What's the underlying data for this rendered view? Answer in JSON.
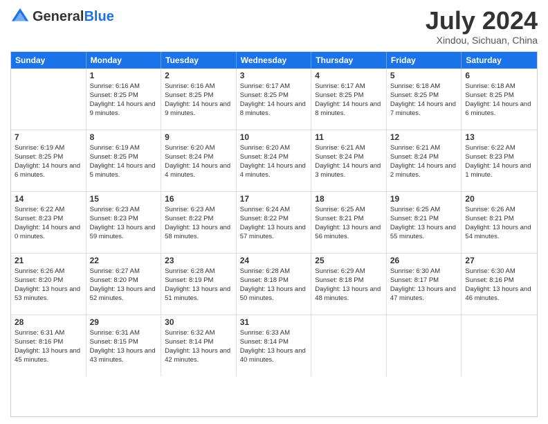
{
  "header": {
    "logo_general": "General",
    "logo_blue": "Blue",
    "month": "July 2024",
    "location": "Xindou, Sichuan, China"
  },
  "days_of_week": [
    "Sunday",
    "Monday",
    "Tuesday",
    "Wednesday",
    "Thursday",
    "Friday",
    "Saturday"
  ],
  "weeks": [
    [
      {
        "day": "",
        "sunrise": "",
        "sunset": "",
        "daylight": ""
      },
      {
        "day": "1",
        "sunrise": "Sunrise: 6:16 AM",
        "sunset": "Sunset: 8:25 PM",
        "daylight": "Daylight: 14 hours and 9 minutes."
      },
      {
        "day": "2",
        "sunrise": "Sunrise: 6:16 AM",
        "sunset": "Sunset: 8:25 PM",
        "daylight": "Daylight: 14 hours and 9 minutes."
      },
      {
        "day": "3",
        "sunrise": "Sunrise: 6:17 AM",
        "sunset": "Sunset: 8:25 PM",
        "daylight": "Daylight: 14 hours and 8 minutes."
      },
      {
        "day": "4",
        "sunrise": "Sunrise: 6:17 AM",
        "sunset": "Sunset: 8:25 PM",
        "daylight": "Daylight: 14 hours and 8 minutes."
      },
      {
        "day": "5",
        "sunrise": "Sunrise: 6:18 AM",
        "sunset": "Sunset: 8:25 PM",
        "daylight": "Daylight: 14 hours and 7 minutes."
      },
      {
        "day": "6",
        "sunrise": "Sunrise: 6:18 AM",
        "sunset": "Sunset: 8:25 PM",
        "daylight": "Daylight: 14 hours and 6 minutes."
      }
    ],
    [
      {
        "day": "7",
        "sunrise": "Sunrise: 6:19 AM",
        "sunset": "Sunset: 8:25 PM",
        "daylight": "Daylight: 14 hours and 6 minutes."
      },
      {
        "day": "8",
        "sunrise": "Sunrise: 6:19 AM",
        "sunset": "Sunset: 8:25 PM",
        "daylight": "Daylight: 14 hours and 5 minutes."
      },
      {
        "day": "9",
        "sunrise": "Sunrise: 6:20 AM",
        "sunset": "Sunset: 8:24 PM",
        "daylight": "Daylight: 14 hours and 4 minutes."
      },
      {
        "day": "10",
        "sunrise": "Sunrise: 6:20 AM",
        "sunset": "Sunset: 8:24 PM",
        "daylight": "Daylight: 14 hours and 4 minutes."
      },
      {
        "day": "11",
        "sunrise": "Sunrise: 6:21 AM",
        "sunset": "Sunset: 8:24 PM",
        "daylight": "Daylight: 14 hours and 3 minutes."
      },
      {
        "day": "12",
        "sunrise": "Sunrise: 6:21 AM",
        "sunset": "Sunset: 8:24 PM",
        "daylight": "Daylight: 14 hours and 2 minutes."
      },
      {
        "day": "13",
        "sunrise": "Sunrise: 6:22 AM",
        "sunset": "Sunset: 8:23 PM",
        "daylight": "Daylight: 14 hours and 1 minute."
      }
    ],
    [
      {
        "day": "14",
        "sunrise": "Sunrise: 6:22 AM",
        "sunset": "Sunset: 8:23 PM",
        "daylight": "Daylight: 14 hours and 0 minutes."
      },
      {
        "day": "15",
        "sunrise": "Sunrise: 6:23 AM",
        "sunset": "Sunset: 8:23 PM",
        "daylight": "Daylight: 13 hours and 59 minutes."
      },
      {
        "day": "16",
        "sunrise": "Sunrise: 6:23 AM",
        "sunset": "Sunset: 8:22 PM",
        "daylight": "Daylight: 13 hours and 58 minutes."
      },
      {
        "day": "17",
        "sunrise": "Sunrise: 6:24 AM",
        "sunset": "Sunset: 8:22 PM",
        "daylight": "Daylight: 13 hours and 57 minutes."
      },
      {
        "day": "18",
        "sunrise": "Sunrise: 6:25 AM",
        "sunset": "Sunset: 8:21 PM",
        "daylight": "Daylight: 13 hours and 56 minutes."
      },
      {
        "day": "19",
        "sunrise": "Sunrise: 6:25 AM",
        "sunset": "Sunset: 8:21 PM",
        "daylight": "Daylight: 13 hours and 55 minutes."
      },
      {
        "day": "20",
        "sunrise": "Sunrise: 6:26 AM",
        "sunset": "Sunset: 8:21 PM",
        "daylight": "Daylight: 13 hours and 54 minutes."
      }
    ],
    [
      {
        "day": "21",
        "sunrise": "Sunrise: 6:26 AM",
        "sunset": "Sunset: 8:20 PM",
        "daylight": "Daylight: 13 hours and 53 minutes."
      },
      {
        "day": "22",
        "sunrise": "Sunrise: 6:27 AM",
        "sunset": "Sunset: 8:20 PM",
        "daylight": "Daylight: 13 hours and 52 minutes."
      },
      {
        "day": "23",
        "sunrise": "Sunrise: 6:28 AM",
        "sunset": "Sunset: 8:19 PM",
        "daylight": "Daylight: 13 hours and 51 minutes."
      },
      {
        "day": "24",
        "sunrise": "Sunrise: 6:28 AM",
        "sunset": "Sunset: 8:18 PM",
        "daylight": "Daylight: 13 hours and 50 minutes."
      },
      {
        "day": "25",
        "sunrise": "Sunrise: 6:29 AM",
        "sunset": "Sunset: 8:18 PM",
        "daylight": "Daylight: 13 hours and 48 minutes."
      },
      {
        "day": "26",
        "sunrise": "Sunrise: 6:30 AM",
        "sunset": "Sunset: 8:17 PM",
        "daylight": "Daylight: 13 hours and 47 minutes."
      },
      {
        "day": "27",
        "sunrise": "Sunrise: 6:30 AM",
        "sunset": "Sunset: 8:16 PM",
        "daylight": "Daylight: 13 hours and 46 minutes."
      }
    ],
    [
      {
        "day": "28",
        "sunrise": "Sunrise: 6:31 AM",
        "sunset": "Sunset: 8:16 PM",
        "daylight": "Daylight: 13 hours and 45 minutes."
      },
      {
        "day": "29",
        "sunrise": "Sunrise: 6:31 AM",
        "sunset": "Sunset: 8:15 PM",
        "daylight": "Daylight: 13 hours and 43 minutes."
      },
      {
        "day": "30",
        "sunrise": "Sunrise: 6:32 AM",
        "sunset": "Sunset: 8:14 PM",
        "daylight": "Daylight: 13 hours and 42 minutes."
      },
      {
        "day": "31",
        "sunrise": "Sunrise: 6:33 AM",
        "sunset": "Sunset: 8:14 PM",
        "daylight": "Daylight: 13 hours and 40 minutes."
      },
      {
        "day": "",
        "sunrise": "",
        "sunset": "",
        "daylight": ""
      },
      {
        "day": "",
        "sunrise": "",
        "sunset": "",
        "daylight": ""
      },
      {
        "day": "",
        "sunrise": "",
        "sunset": "",
        "daylight": ""
      }
    ]
  ]
}
